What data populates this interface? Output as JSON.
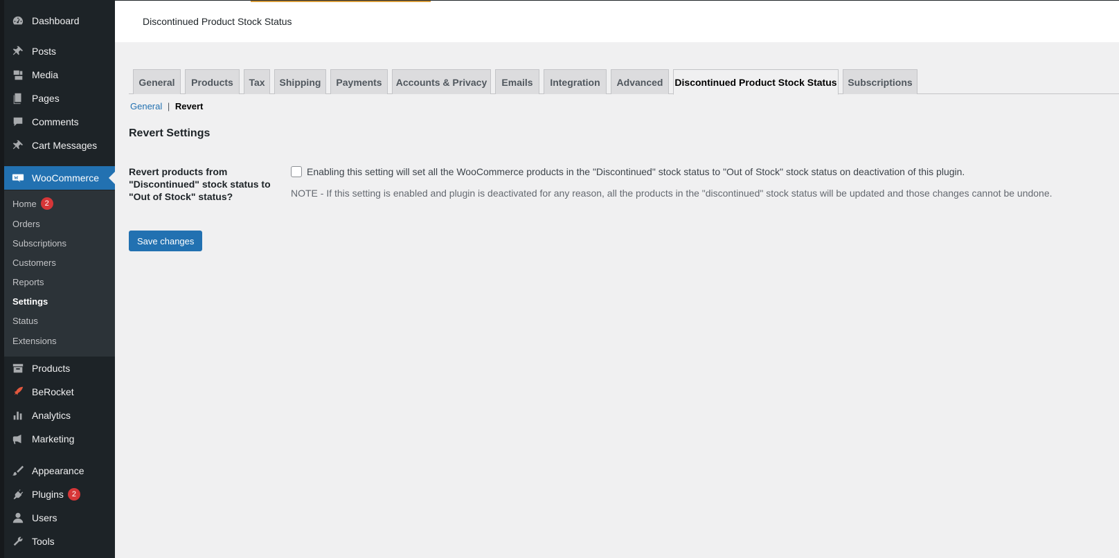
{
  "topbar": {
    "title": "Discontinued Product Stock Status"
  },
  "menu": [
    {
      "label": "Dashboard",
      "icon": "dashboard-icon"
    },
    {
      "label": "Posts",
      "icon": "pin-icon"
    },
    {
      "label": "Media",
      "icon": "media-icon"
    },
    {
      "label": "Pages",
      "icon": "pages-icon"
    },
    {
      "label": "Comments",
      "icon": "comments-icon"
    },
    {
      "label": "Cart Messages",
      "icon": "pin-icon"
    },
    {
      "label": "WooCommerce",
      "icon": "woo-icon"
    },
    {
      "label": "Products",
      "icon": "archive-icon"
    },
    {
      "label": "BeRocket",
      "icon": "rocket-icon"
    },
    {
      "label": "Analytics",
      "icon": "bar-chart-icon"
    },
    {
      "label": "Marketing",
      "icon": "megaphone-icon"
    },
    {
      "label": "Appearance",
      "icon": "brush-icon"
    },
    {
      "label": "Plugins",
      "icon": "plugin-icon",
      "badge": "2"
    },
    {
      "label": "Users",
      "icon": "user-icon"
    },
    {
      "label": "Tools",
      "icon": "wrench-icon"
    }
  ],
  "submenu": [
    {
      "label": "Home",
      "badge": "2"
    },
    {
      "label": "Orders"
    },
    {
      "label": "Subscriptions"
    },
    {
      "label": "Customers"
    },
    {
      "label": "Reports"
    },
    {
      "label": "Settings"
    },
    {
      "label": "Status"
    },
    {
      "label": "Extensions"
    }
  ],
  "tabs": [
    "General",
    "Products",
    "Tax",
    "Shipping",
    "Payments",
    "Accounts & Privacy",
    "Emails",
    "Integration",
    "Advanced",
    "Discontinued Product Stock Status",
    "Subscriptions"
  ],
  "subnav": {
    "general": "General",
    "separator": "|",
    "current": "Revert"
  },
  "section": {
    "title": "Revert Settings",
    "field_label": "Revert products from \"Discontinued\" stock status to \"Out of Stock\" status?",
    "field_desc": "Enabling this setting will set all the WooCommerce products in the \"Discontinued\" stock status to \"Out of Stock\" stock status on deactivation of this plugin.",
    "note": "NOTE - If this setting is enabled and plugin is deactivated for any reason, all the products in the \"discontinued\" stock status will be updated and those changes cannot be undone."
  },
  "save_label": "Save changes",
  "colors": {
    "accent": "#2271b1",
    "menu_bg": "#1d2327",
    "badge": "#d63638"
  }
}
